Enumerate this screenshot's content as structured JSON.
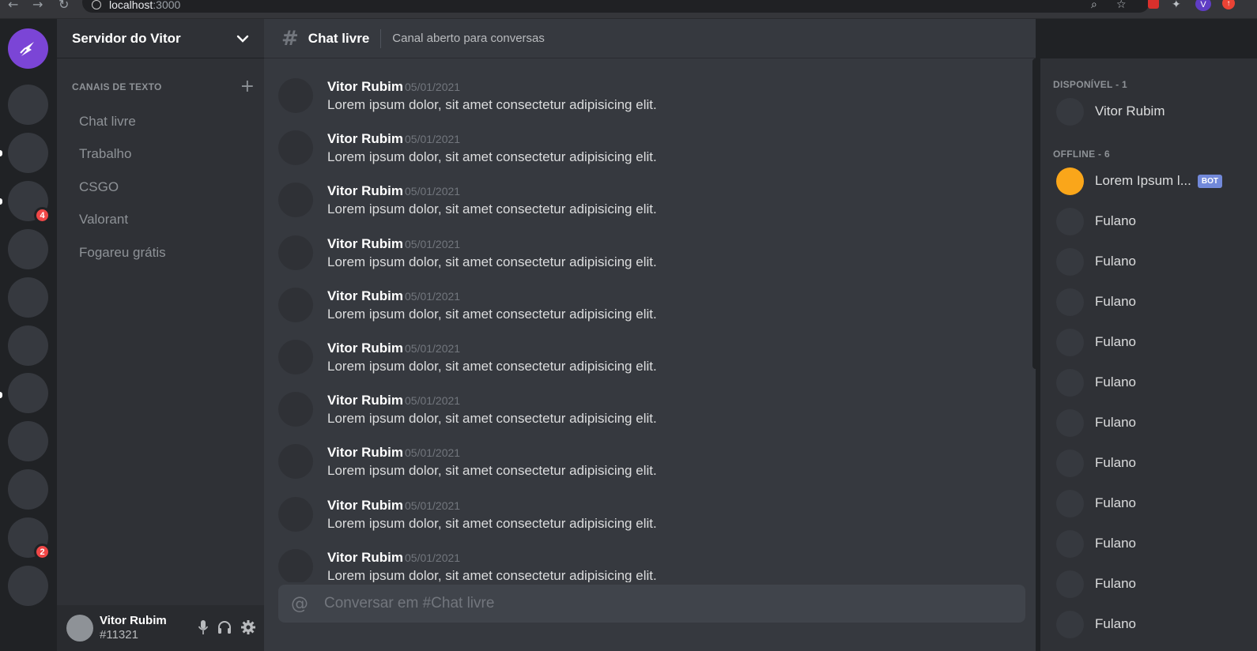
{
  "browser": {
    "url_host": "localhost",
    "url_port": ":3000",
    "profile_initial": "V"
  },
  "servers": {
    "items": [
      {
        "name": "home-server",
        "badge": null
      },
      {
        "name": "server-1",
        "badge": null
      },
      {
        "name": "server-2",
        "badge": null
      },
      {
        "name": "server-3",
        "badge": "4"
      },
      {
        "name": "server-4",
        "badge": null
      },
      {
        "name": "server-5",
        "badge": null
      },
      {
        "name": "server-6",
        "badge": null
      },
      {
        "name": "server-7",
        "badge": null
      },
      {
        "name": "server-8",
        "badge": null
      },
      {
        "name": "server-9",
        "badge": null
      },
      {
        "name": "server-10",
        "badge": "2"
      },
      {
        "name": "server-11",
        "badge": null
      }
    ]
  },
  "sidebar": {
    "server_name": "Servidor do Vitor",
    "category_label": "CANAIS DE TEXTO",
    "channels": [
      "Chat livre",
      "Trabalho",
      "CSGO",
      "Valorant",
      "Fogareu grátis"
    ]
  },
  "user_panel": {
    "name": "Vitor Rubim",
    "tag": "#11321"
  },
  "header": {
    "channel_name": "Chat livre",
    "channel_desc": "Canal aberto para conversas"
  },
  "messages": [
    {
      "author": "Vitor Rubim",
      "date": "05/01/2021",
      "text": "Lorem ipsum dolor, sit amet consectetur adipisicing elit."
    },
    {
      "author": "Vitor Rubim",
      "date": "05/01/2021",
      "text": "Lorem ipsum dolor, sit amet consectetur adipisicing elit."
    },
    {
      "author": "Vitor Rubim",
      "date": "05/01/2021",
      "text": "Lorem ipsum dolor, sit amet consectetur adipisicing elit."
    },
    {
      "author": "Vitor Rubim",
      "date": "05/01/2021",
      "text": "Lorem ipsum dolor, sit amet consectetur adipisicing elit."
    },
    {
      "author": "Vitor Rubim",
      "date": "05/01/2021",
      "text": "Lorem ipsum dolor, sit amet consectetur adipisicing elit."
    },
    {
      "author": "Vitor Rubim",
      "date": "05/01/2021",
      "text": "Lorem ipsum dolor, sit amet consectetur adipisicing elit."
    },
    {
      "author": "Vitor Rubim",
      "date": "05/01/2021",
      "text": "Lorem ipsum dolor, sit amet consectetur adipisicing elit."
    },
    {
      "author": "Vitor Rubim",
      "date": "05/01/2021",
      "text": "Lorem ipsum dolor, sit amet consectetur adipisicing elit."
    },
    {
      "author": "Vitor Rubim",
      "date": "05/01/2021",
      "text": "Lorem ipsum dolor, sit amet consectetur adipisicing elit."
    },
    {
      "author": "Vitor Rubim",
      "date": "05/01/2021",
      "text": "Lorem ipsum dolor, sit amet consectetur adipisicing elit."
    }
  ],
  "composer": {
    "placeholder": "Conversar em #Chat livre"
  },
  "members": {
    "online_label": "DISPONÍVEL - 1",
    "online": [
      "Vitor Rubim"
    ],
    "offline_label": "OFFLINE - 6",
    "bot_name": "Lorem Ipsum l...",
    "bot_tag": "BOT",
    "offline": [
      "Fulano",
      "Fulano",
      "Fulano",
      "Fulano",
      "Fulano",
      "Fulano",
      "Fulano",
      "Fulano",
      "Fulano",
      "Fulano",
      "Fulano"
    ]
  },
  "colors": {
    "accent": "#7b45d6",
    "badge": "#f04747",
    "bot": "#7289da",
    "bot_avatar": "#faa61a"
  }
}
